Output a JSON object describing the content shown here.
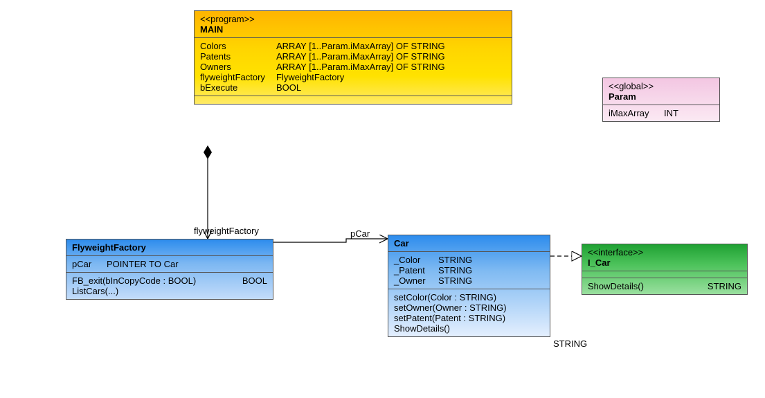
{
  "main": {
    "stereotype": "<<program>>",
    "name": "MAIN",
    "attrs": [
      {
        "name": "Colors",
        "type": "ARRAY [1..Param.iMaxArray] OF STRING"
      },
      {
        "name": "Patents",
        "type": "ARRAY [1..Param.iMaxArray] OF STRING"
      },
      {
        "name": "Owners",
        "type": "ARRAY [1..Param.iMaxArray] OF STRING"
      },
      {
        "name": "flyweightFactory",
        "type": "FlyweightFactory"
      },
      {
        "name": "bExecute",
        "type": "BOOL"
      }
    ]
  },
  "param": {
    "stereotype": "<<global>>",
    "name": "Param",
    "attrs": [
      {
        "name": "iMaxArray",
        "type": "INT"
      }
    ]
  },
  "ff": {
    "name": "FlyweightFactory",
    "attrs": [
      {
        "name": "pCar",
        "type": "POINTER TO Car"
      }
    ],
    "ops": [
      {
        "sig": "FB_exit(bInCopyCode : BOOL)",
        "ret": "BOOL"
      },
      {
        "sig": "ListCars(...)",
        "ret": ""
      }
    ]
  },
  "car": {
    "name": "Car",
    "attrs": [
      {
        "name": "_Color",
        "type": "STRING"
      },
      {
        "name": "_Patent",
        "type": "STRING"
      },
      {
        "name": "_Owner",
        "type": "STRING"
      }
    ],
    "ops": [
      {
        "sig": "setColor(Color : STRING)",
        "ret": ""
      },
      {
        "sig": "setOwner(Owner : STRING)",
        "ret": ""
      },
      {
        "sig": "setPatent(Patent : STRING)",
        "ret": ""
      },
      {
        "sig": "ShowDetails()",
        "ret": "STRING"
      }
    ]
  },
  "icar": {
    "stereotype": "<<interface>>",
    "name": "I_Car",
    "ops": [
      {
        "sig": "ShowDetails()",
        "ret": "STRING"
      }
    ]
  },
  "labels": {
    "flyweightFactory": "flyweightFactory",
    "pCar": "pCar"
  },
  "chart_data": {
    "type": "table",
    "diagram_type": "uml-class",
    "classes": [
      {
        "name": "MAIN",
        "stereotype": "program",
        "attributes": [
          [
            "Colors",
            "ARRAY [1..Param.iMaxArray] OF STRING"
          ],
          [
            "Patents",
            "ARRAY [1..Param.iMaxArray] OF STRING"
          ],
          [
            "Owners",
            "ARRAY [1..Param.iMaxArray] OF STRING"
          ],
          [
            "flyweightFactory",
            "FlyweightFactory"
          ],
          [
            "bExecute",
            "BOOL"
          ]
        ],
        "operations": []
      },
      {
        "name": "Param",
        "stereotype": "global",
        "attributes": [
          [
            "iMaxArray",
            "INT"
          ]
        ],
        "operations": []
      },
      {
        "name": "FlyweightFactory",
        "attributes": [
          [
            "pCar",
            "POINTER TO Car"
          ]
        ],
        "operations": [
          [
            "FB_exit(bInCopyCode : BOOL)",
            "BOOL"
          ],
          [
            "ListCars(...)",
            ""
          ]
        ]
      },
      {
        "name": "Car",
        "attributes": [
          [
            "_Color",
            "STRING"
          ],
          [
            "_Patent",
            "STRING"
          ],
          [
            "_Owner",
            "STRING"
          ]
        ],
        "operations": [
          [
            "setColor(Color : STRING)",
            ""
          ],
          [
            "setOwner(Owner : STRING)",
            ""
          ],
          [
            "setPatent(Patent : STRING)",
            ""
          ],
          [
            "ShowDetails()",
            "STRING"
          ]
        ]
      },
      {
        "name": "I_Car",
        "stereotype": "interface",
        "attributes": [],
        "operations": [
          [
            "ShowDetails()",
            "STRING"
          ]
        ]
      }
    ],
    "relations": [
      {
        "from": "MAIN",
        "to": "FlyweightFactory",
        "kind": "composition",
        "label": "flyweightFactory"
      },
      {
        "from": "FlyweightFactory",
        "to": "Car",
        "kind": "association",
        "label": "pCar"
      },
      {
        "from": "Car",
        "to": "I_Car",
        "kind": "realization"
      }
    ]
  }
}
